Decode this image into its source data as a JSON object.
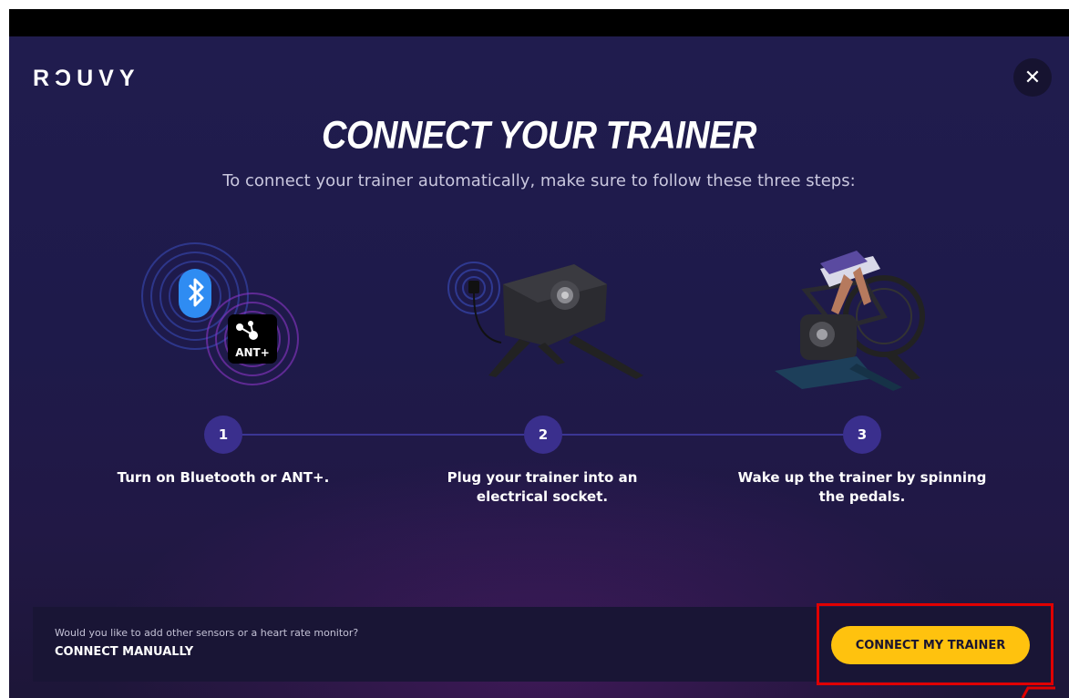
{
  "app": {
    "logo_text": "RϽUVY"
  },
  "dialog": {
    "title": "CONNECT YOUR TRAINER",
    "subtitle": "To connect your trainer automatically, make sure to follow these three steps:",
    "close_icon": "close-icon"
  },
  "steps": [
    {
      "number": "1",
      "text_line1": "Turn on Bluetooth or ANT+.",
      "text_line2": "",
      "illustration": "bluetooth-ant-icon"
    },
    {
      "number": "2",
      "text_line1": "Plug your trainer into an",
      "text_line2": "electrical socket.",
      "illustration": "trainer-plug-icon"
    },
    {
      "number": "3",
      "text_line1": "Wake up the trainer by spinning",
      "text_line2": "the pedals.",
      "illustration": "cyclist-trainer-icon"
    }
  ],
  "ant_label": "ANT+",
  "footer": {
    "question": "Would you like to add other sensors or a heart rate monitor?",
    "manual_link": "CONNECT MANUALLY",
    "cta_label": "CONNECT MY TRAINER"
  },
  "colors": {
    "background": "#201c4e",
    "accent": "#ffc20e",
    "step_circle": "#3a2f8d",
    "highlight": "#e00000"
  }
}
